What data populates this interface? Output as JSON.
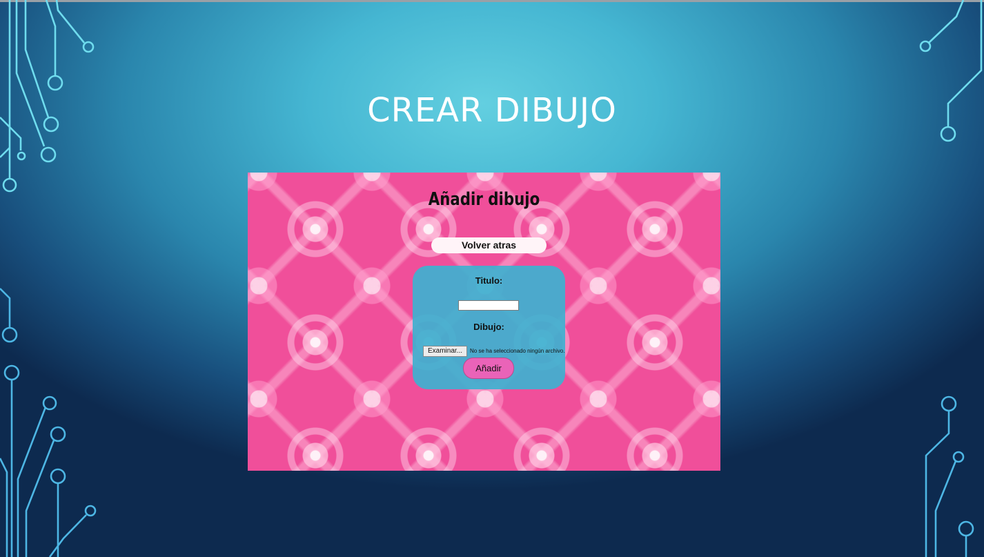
{
  "slide": {
    "title": "CREAR DIBUJO"
  },
  "screenshot": {
    "heading": "Añadir dibujo",
    "back_button": "Volver atras",
    "form": {
      "title_label": "Titulo:",
      "title_value": "",
      "drawing_label": "Dibujo:",
      "file_button": "Examinar...",
      "file_status": "No se ha seleccionado ningún archivo.",
      "submit_button": "Añadir"
    }
  },
  "colors": {
    "slide_background": "#2a86ad",
    "circuit_lines": "#6fe0f0",
    "page_background": "#f04f9a",
    "form_card": "#40b0d0",
    "submit_button": "#ea63b8"
  }
}
